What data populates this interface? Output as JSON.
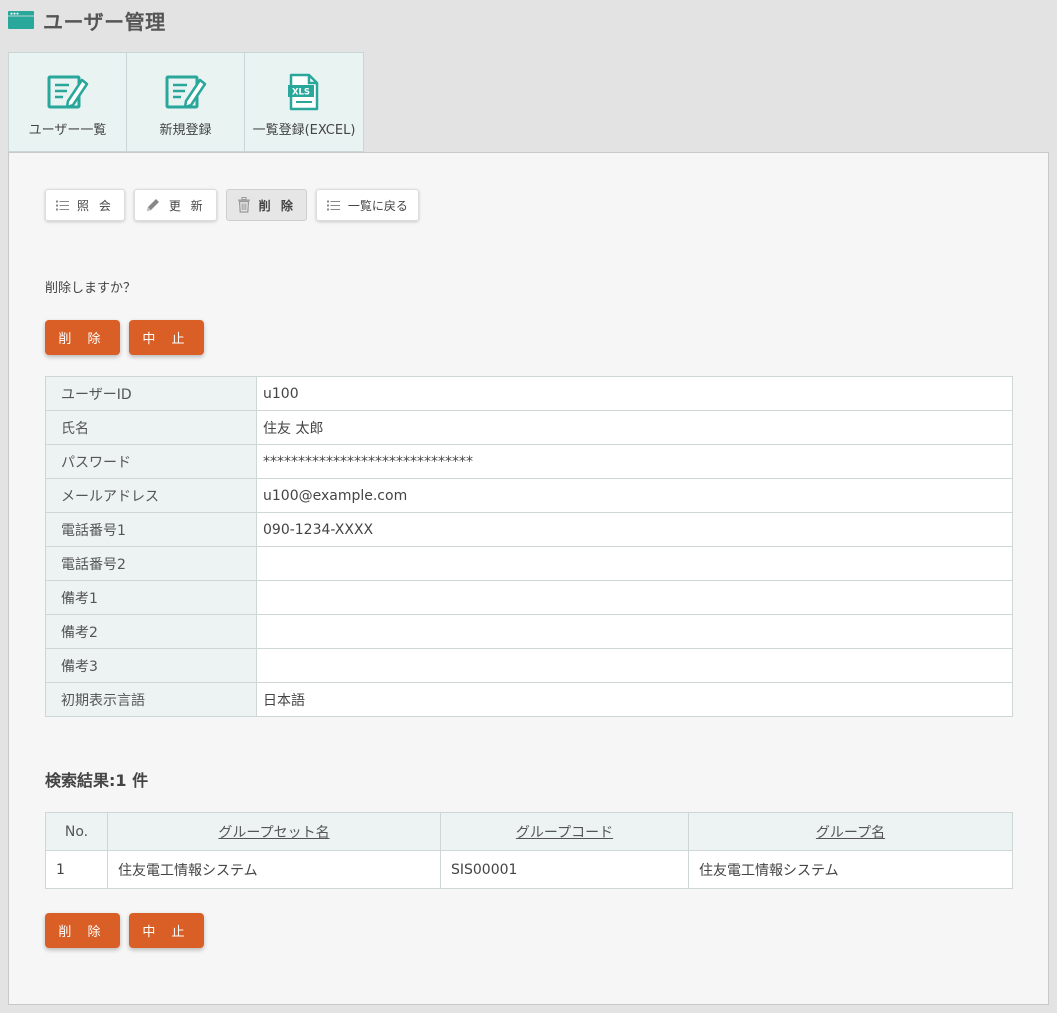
{
  "header": {
    "title": "ユーザー管理"
  },
  "tabs": [
    {
      "label": "ユーザー一覧",
      "icon": "edit-document-icon"
    },
    {
      "label": "新規登録",
      "icon": "edit-document-icon"
    },
    {
      "label": "一覧登録(EXCEL)",
      "icon": "xls-file-icon",
      "badge": "XLS"
    }
  ],
  "toolbar": {
    "view_label": "照 会",
    "update_label": "更 新",
    "delete_label": "削 除",
    "back_label": "一覧に戻る"
  },
  "confirm_message": "削除しますか？",
  "actions": {
    "delete_label": "削 除",
    "cancel_label": "中 止"
  },
  "detail": {
    "rows": [
      {
        "label": "ユーザーID",
        "value": "u100"
      },
      {
        "label": "氏名",
        "value": "住友 太郎"
      },
      {
        "label": "パスワード",
        "value": "******************************"
      },
      {
        "label": "メールアドレス",
        "value": "u100@example.com"
      },
      {
        "label": "電話番号1",
        "value": "090-1234-XXXX"
      },
      {
        "label": "電話番号2",
        "value": ""
      },
      {
        "label": "備考1",
        "value": ""
      },
      {
        "label": "備考2",
        "value": ""
      },
      {
        "label": "備考3",
        "value": ""
      },
      {
        "label": "初期表示言語",
        "value": "日本語"
      }
    ]
  },
  "result": {
    "title": "検索結果:1 件",
    "columns": [
      "No.",
      "グループセット名",
      "グループコード",
      "グループ名"
    ],
    "rows": [
      {
        "no": "1",
        "group_set": "住友電工情報システム",
        "group_code": "SIS00001",
        "group_name": "住友電工情報システム"
      }
    ]
  },
  "colors": {
    "accent": "#d95f26",
    "teal": "#2aa79b",
    "label_bg": "#ecf3f2"
  }
}
